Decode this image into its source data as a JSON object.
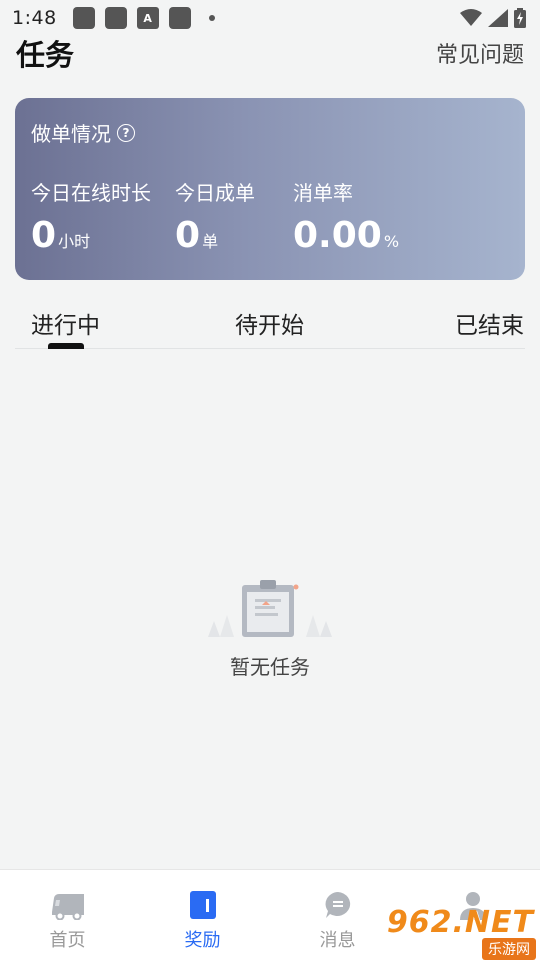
{
  "status_bar": {
    "time": "1:48",
    "icons_left": [
      "app-square-icon",
      "app-square-icon",
      "a-font-icon",
      "app-square-icon",
      "dot-icon"
    ],
    "icons_right": [
      "wifi-icon",
      "signal-icon",
      "battery-charging-icon"
    ]
  },
  "header": {
    "title": "任务",
    "faq_label": "常见问题"
  },
  "stats_card": {
    "title": "做单情况",
    "help_icon": "question-circle-icon",
    "metrics": [
      {
        "label": "今日在线时长",
        "value": "0",
        "unit": "小时"
      },
      {
        "label": "今日成单",
        "value": "0",
        "unit": "单"
      },
      {
        "label": "消单率",
        "value": "0.00",
        "unit": "%"
      }
    ],
    "gradient_colors": [
      "#6c7193",
      "#a6b4ce"
    ]
  },
  "tabs": {
    "items": [
      {
        "label": "进行中",
        "active": true
      },
      {
        "label": "待开始",
        "active": false
      },
      {
        "label": "已结束",
        "active": false
      }
    ]
  },
  "empty_state": {
    "text": "暂无任务",
    "icon": "clipboard-empty-icon"
  },
  "bottom_nav": {
    "items": [
      {
        "label": "首页",
        "icon": "truck-icon",
        "active": false
      },
      {
        "label": "奖励",
        "icon": "reward-card-icon",
        "active": true
      },
      {
        "label": "消息",
        "icon": "chat-bubble-icon",
        "active": false
      },
      {
        "label": "",
        "icon": "person-icon",
        "active": false
      }
    ],
    "active_color": "#2a6bf3",
    "inactive_color": "#999999"
  },
  "watermark": {
    "logo": "962.NET",
    "sub": "乐游网"
  }
}
